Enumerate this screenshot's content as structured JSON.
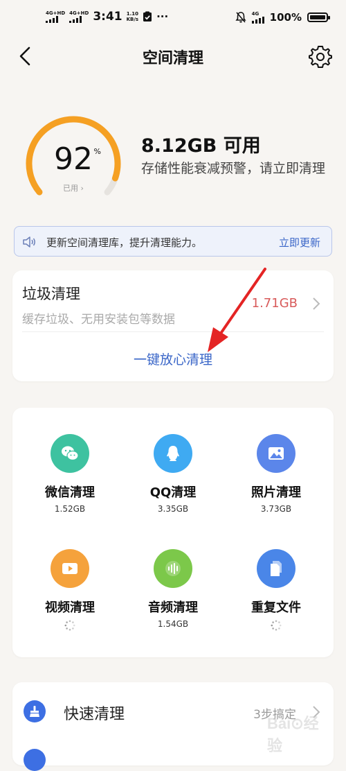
{
  "status_bar": {
    "signal1_label": "4G+HD",
    "signal2_label": "4G+HD",
    "time": "3:41",
    "net_speed_value": "1.10",
    "net_speed_unit": "KB/s",
    "more": "···",
    "net_type": "4G",
    "battery": "100%"
  },
  "nav": {
    "title": "空间清理"
  },
  "storage": {
    "used_percent": 92,
    "used_percent_text": "92",
    "percent_sign": "%",
    "used_label": "已用 ›",
    "free_text": "8.12GB 可用",
    "warning_text": "存储性能衰减预警，请立即清理"
  },
  "update_banner": {
    "text": "更新空间清理库，提升清理能力。",
    "action": "立即更新"
  },
  "junk": {
    "title": "垃圾清理",
    "subtitle": "缓存垃圾、无用安装包等数据",
    "size": "1.71GB",
    "action": "一键放心清理"
  },
  "tiles": [
    {
      "label": "微信清理",
      "size": "1.52GB",
      "color": "#3ec2a0",
      "icon": "wechat-icon"
    },
    {
      "label": "QQ清理",
      "size": "3.35GB",
      "color": "#3faaf2",
      "icon": "qq-penguin-icon"
    },
    {
      "label": "照片清理",
      "size": "3.73GB",
      "color": "#5b86ea",
      "icon": "photo-icon"
    },
    {
      "label": "视频清理",
      "size": "",
      "color": "#f5a23c",
      "icon": "video-play-icon"
    },
    {
      "label": "音频清理",
      "size": "1.54GB",
      "color": "#7cc84a",
      "icon": "audio-wave-icon"
    },
    {
      "label": "重复文件",
      "size": "",
      "color": "#4a86e8",
      "icon": "duplicate-file-icon"
    }
  ],
  "quick_clean": {
    "title": "快速清理",
    "value": "3步搞定"
  },
  "watermark": "Bai⊙经验",
  "colors": {
    "accent_blue": "#3a66c8",
    "gauge_orange": "#f5a023",
    "warning_red": "#d85a5a"
  }
}
